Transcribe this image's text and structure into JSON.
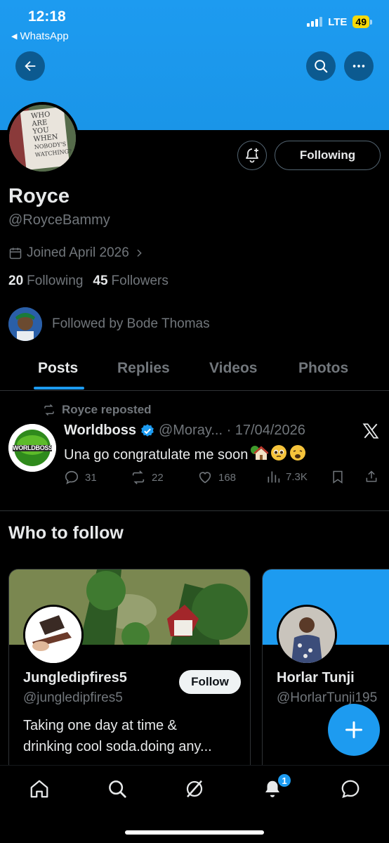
{
  "status_bar": {
    "time": "12:18",
    "back_app": "WhatsApp",
    "network": "LTE",
    "battery": "49"
  },
  "header": {
    "back_icon": "arrow-left-icon",
    "search_icon": "search-icon",
    "more_icon": "more-horizontal-icon",
    "banner_color": "#1d9bf0"
  },
  "profile": {
    "avatar_text": [
      "WHO",
      "ARE",
      "YOU",
      "WHEN",
      "NOBODY'S",
      "WATCHING?"
    ],
    "name": "Royce",
    "handle": "@RoyceBammy",
    "joined": "Joined April 2026",
    "following_count": "20",
    "following_label": "Following",
    "followers_count": "45",
    "followers_label": "Followers",
    "followed_by": "Followed by Bode Thomas",
    "following_button": "Following"
  },
  "tabs": [
    "Posts",
    "Replies",
    "Videos",
    "Photos"
  ],
  "active_tab": "Posts",
  "post": {
    "repost_label": "Royce reposted",
    "avatar_text": "WORLDBOSS",
    "author": "Worldboss",
    "verified": true,
    "handle_date": "@Moray... · 17/04/2026",
    "text": "Una go congratulate me soon",
    "emojis": [
      "house-with-garden",
      "pleading-face",
      "weary-face"
    ],
    "replies": "31",
    "reposts": "22",
    "likes": "168",
    "views": "7.3K"
  },
  "who_to_follow": {
    "title": "Who to follow",
    "cards": [
      {
        "name": "Jungledipfires5",
        "handle": "@jungledipfires5",
        "follow_label": "Follow",
        "bio_line1": "Taking one day at time &",
        "bio_line2": "drinking cool soda.doing any..."
      },
      {
        "name": "Horlar Tunji",
        "handle": "@HorlarTunji195"
      }
    ]
  },
  "bottom_nav": {
    "items": [
      "home-icon",
      "search-icon",
      "grok-icon",
      "notifications-icon",
      "messages-icon"
    ],
    "notification_badge": "1"
  },
  "colors": {
    "accent": "#1d9bf0",
    "text_primary": "#e7e9ea",
    "text_secondary": "#71767b",
    "border": "#2f3336"
  }
}
